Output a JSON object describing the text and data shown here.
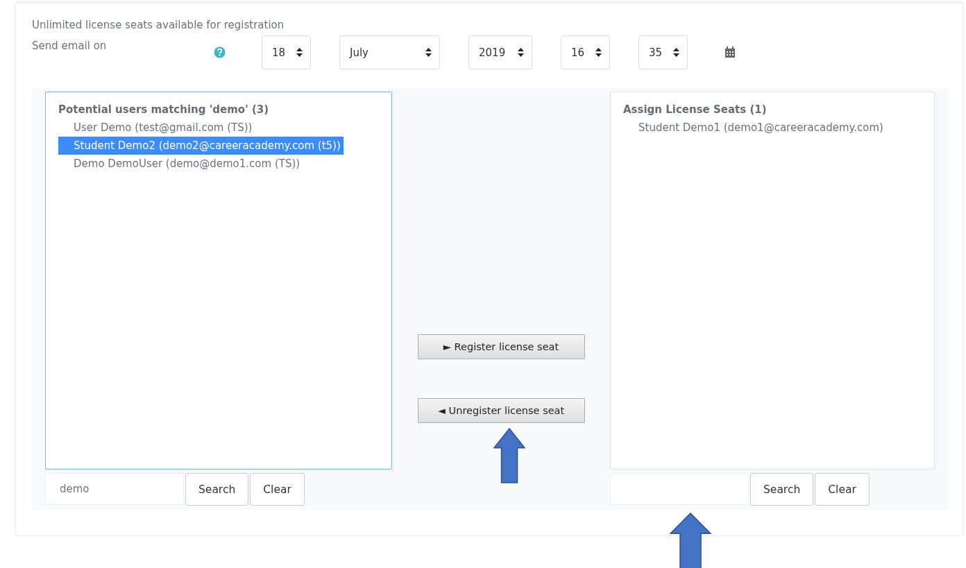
{
  "info": "Unlimited license seats available for registration",
  "send_email": {
    "label": "Send email on",
    "fields": [
      {
        "kind": "day",
        "value": "18"
      },
      {
        "kind": "month",
        "value": "July"
      },
      {
        "kind": "year",
        "value": "2019"
      },
      {
        "kind": "hour",
        "value": "16"
      },
      {
        "kind": "minute",
        "value": "35"
      }
    ]
  },
  "potential_users": {
    "heading": "Potential users matching 'demo' (3)",
    "items": [
      {
        "label": "User Demo (test@gmail.com (TS))",
        "selected": false
      },
      {
        "label": "Student Demo2 (demo2@careeracademy.com (t5))",
        "selected": true
      },
      {
        "label": "Demo DemoUser (demo@demo1.com (TS))",
        "selected": false
      }
    ],
    "search": {
      "placeholder": "demo"
    },
    "buttons": [
      "Search",
      "Clear"
    ]
  },
  "actions": [
    "► Register license seat",
    "◄ Unregister license seat"
  ],
  "assigned": {
    "heading": "Assign License Seats (1)",
    "items": [
      {
        "label": "Student Demo1 (demo1@careeracademy.com)",
        "selected": false
      }
    ],
    "buttons": [
      "Search",
      "Clear"
    ]
  }
}
